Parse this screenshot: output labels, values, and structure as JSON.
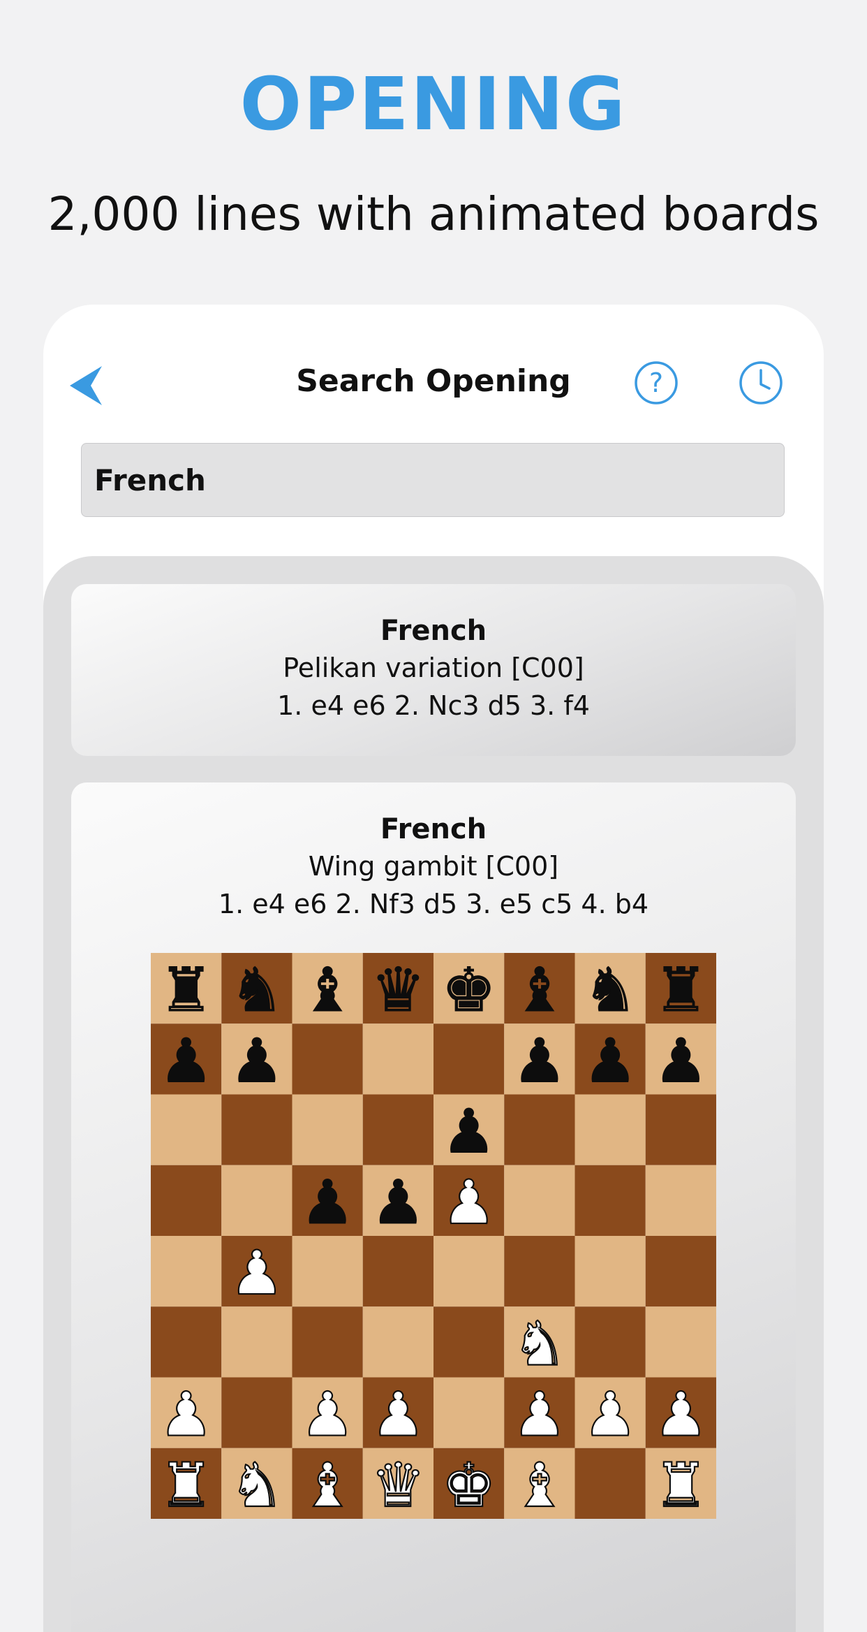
{
  "hero": {
    "title": "OPENING",
    "subtitle": "2,000 lines with animated boards"
  },
  "colors": {
    "accent": "#3a9ae1",
    "light_square": "#e1b684",
    "dark_square": "#8a4a1c"
  },
  "nav": {
    "back_icon": "back-arrow-icon",
    "title": "Search Opening",
    "help_icon": "help-icon",
    "history_icon": "clock-icon"
  },
  "search": {
    "value": "French"
  },
  "results": [
    {
      "name": "French",
      "variation": "Pelikan variation [C00]",
      "moves": "1. e4 e6 2. Nc3 d5 3. f4"
    },
    {
      "name": "French",
      "variation": "Wing gambit [C00]",
      "moves": "1. e4 e6 2. Nf3 d5 3. e5 c5 4. b4",
      "board": [
        "rnbqkbnr",
        "pp...ppp",
        "....p...",
        "..ppP...",
        ".P......",
        ".....N..",
        "P.PP.PPP",
        "RNBQKB.R"
      ]
    }
  ]
}
